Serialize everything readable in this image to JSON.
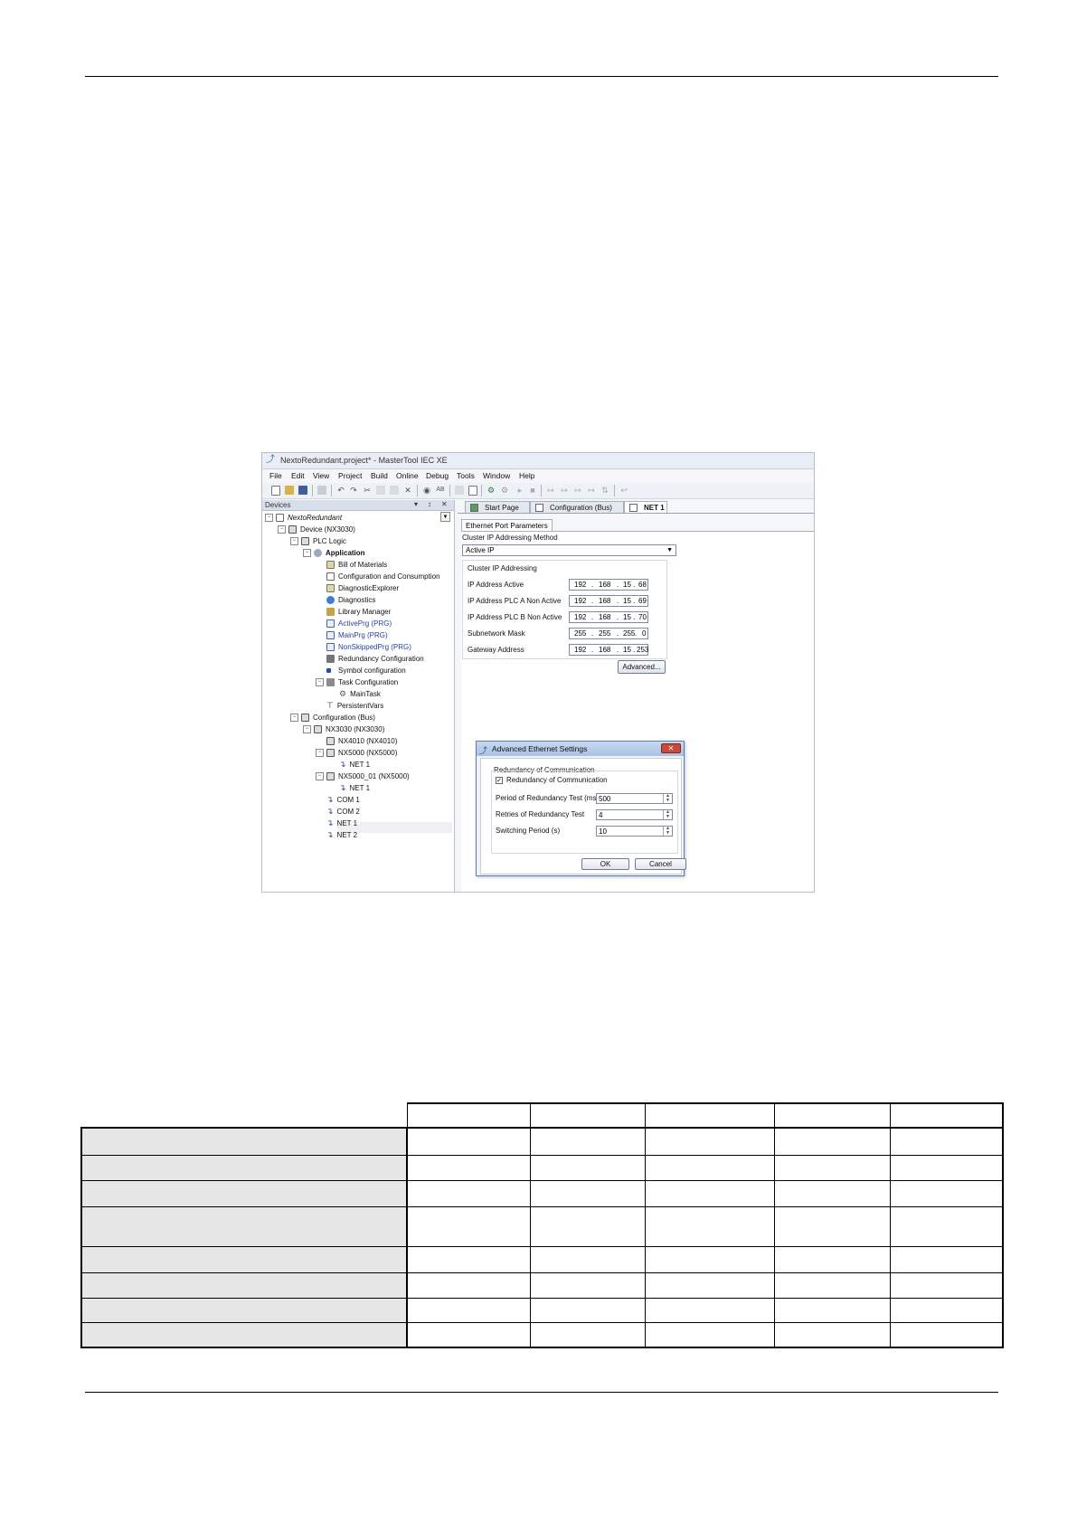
{
  "window": {
    "title": "NextoRedundant.project* - MasterTool IEC XE",
    "menu": [
      "File",
      "Edit",
      "View",
      "Project",
      "Build",
      "Online",
      "Debug",
      "Tools",
      "Window",
      "Help"
    ]
  },
  "devices_pane": {
    "title": "Devices",
    "pin_glyph": "↕",
    "close_glyph": "✕",
    "tree": [
      {
        "label": "NextoRedundant",
        "icon": "project-icon"
      },
      {
        "label": "Device (NX3030)",
        "icon": "device-icon"
      },
      {
        "label": "PLC Logic",
        "icon": "plc-logic-icon"
      },
      {
        "label": "Application",
        "icon": "application-icon"
      },
      {
        "label": "Bill of Materials",
        "icon": "bill-of-materials-icon"
      },
      {
        "label": "Configuration and Consumption",
        "icon": "document-icon"
      },
      {
        "label": "DiagnosticExplorer",
        "icon": "diagnostic-explorer-icon"
      },
      {
        "label": "Diagnostics",
        "icon": "globe-icon"
      },
      {
        "label": "Library Manager",
        "icon": "library-icon"
      },
      {
        "label": "ActivePrg (PRG)",
        "icon": "program-icon"
      },
      {
        "label": "MainPrg (PRG)",
        "icon": "program-icon"
      },
      {
        "label": "NonSkippedPrg (PRG)",
        "icon": "program-icon"
      },
      {
        "label": "Redundancy Configuration",
        "icon": "redundancy-icon"
      },
      {
        "label": "Symbol configuration",
        "icon": "symbol-icon"
      },
      {
        "label": "Task Configuration",
        "icon": "task-config-icon"
      },
      {
        "label": "MainTask",
        "icon": "gear-icon"
      },
      {
        "label": "PersistentVars",
        "icon": "persistent-vars-icon"
      },
      {
        "label": "Configuration (Bus)",
        "icon": "bus-icon"
      },
      {
        "label": "NX3030 (NX3030)",
        "icon": "device-icon"
      },
      {
        "label": "NX4010 (NX4010)",
        "icon": "device-icon"
      },
      {
        "label": "NX5000 (NX5000)",
        "icon": "device-icon"
      },
      {
        "label": "NET 1",
        "icon": "network-icon"
      },
      {
        "label": "NX5000_01 (NX5000)",
        "icon": "device-icon"
      },
      {
        "label": "NET 1",
        "icon": "network-icon"
      },
      {
        "label": "COM 1",
        "icon": "network-icon"
      },
      {
        "label": "COM 2",
        "icon": "network-icon"
      },
      {
        "label": "NET 1",
        "icon": "network-icon"
      },
      {
        "label": "NET 2",
        "icon": "network-icon"
      }
    ]
  },
  "editor": {
    "tabs": [
      "Start Page",
      "Configuration (Bus)",
      "NET 1"
    ],
    "subtab": "Ethernet Port Parameters",
    "method_label": "Cluster IP Addressing Method",
    "method_value": "Active IP",
    "group_title": "Cluster IP Addressing",
    "fields": [
      {
        "label": "IP Address Active",
        "octets": [
          "192",
          "168",
          "15",
          "68"
        ]
      },
      {
        "label": "IP Address PLC A Non Active",
        "octets": [
          "192",
          "168",
          "15",
          "69"
        ]
      },
      {
        "label": "IP Address PLC B Non Active",
        "octets": [
          "192",
          "168",
          "15",
          "70"
        ]
      },
      {
        "label": "Subnetwork Mask",
        "octets": [
          "255",
          "255",
          "255",
          "0"
        ]
      },
      {
        "label": "Gateway Address",
        "octets": [
          "192",
          "168",
          "15",
          "253"
        ]
      }
    ],
    "advanced_button": "Advanced..."
  },
  "dialog": {
    "title": "Advanced Ethernet Settings",
    "close_glyph": "✕",
    "group_title": "Redundancy of Communication",
    "checkbox_label": "Redundancy of Communication",
    "checkbox_checked": true,
    "fields": [
      {
        "label": "Period of Redundancy Test (ms)",
        "value": "500"
      },
      {
        "label": "Retries of Redundancy Test",
        "value": "4"
      },
      {
        "label": "Switching Period (s)",
        "value": "10"
      }
    ],
    "ok": "OK",
    "cancel": "Cancel"
  },
  "table": {
    "header": [
      "",
      "",
      "",
      "",
      "",
      ""
    ],
    "rows": [
      [
        "",
        "",
        "",
        "",
        "",
        ""
      ],
      [
        "",
        "",
        "",
        "",
        "",
        ""
      ],
      [
        "",
        "",
        "",
        "",
        "",
        ""
      ],
      [
        "",
        "",
        "",
        "",
        "",
        ""
      ],
      [
        "",
        "",
        "",
        "",
        "",
        ""
      ],
      [
        "",
        "",
        "",
        "",
        "",
        ""
      ],
      [
        "",
        "",
        "",
        "",
        "",
        ""
      ],
      [
        "",
        "",
        "",
        "",
        "",
        ""
      ]
    ]
  }
}
